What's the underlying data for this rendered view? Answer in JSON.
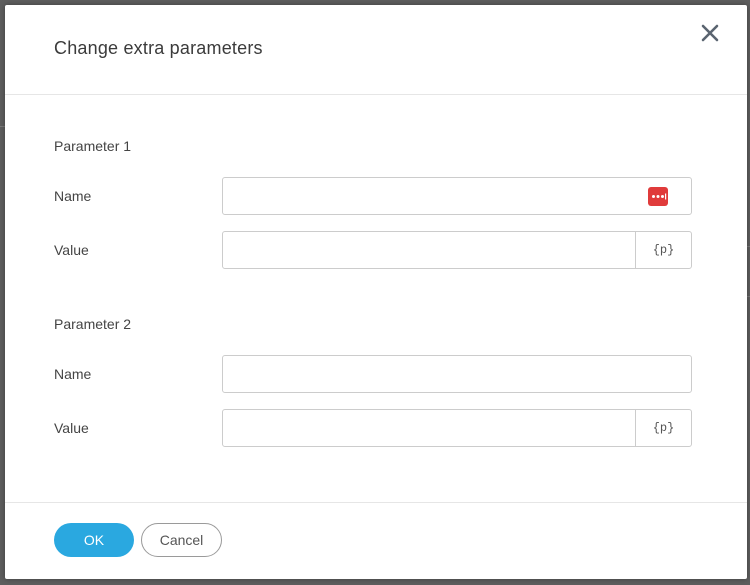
{
  "dialog": {
    "title": "Change extra parameters",
    "close_icon": "close-icon"
  },
  "parameters": [
    {
      "heading": "Parameter 1",
      "name_label": "Name",
      "name_value": "",
      "value_label": "Value",
      "value_value": "",
      "param_button_label": "{p}",
      "name_has_password_icon": true
    },
    {
      "heading": "Parameter 2",
      "name_label": "Name",
      "name_value": "",
      "value_label": "Value",
      "value_value": "",
      "param_button_label": "{p}",
      "name_has_password_icon": false
    }
  ],
  "footer": {
    "ok_label": "OK",
    "cancel_label": "Cancel"
  },
  "colors": {
    "accent": "#2aa8e0",
    "password_icon": "#e03b3b",
    "overlay": "#5e5e5e"
  }
}
